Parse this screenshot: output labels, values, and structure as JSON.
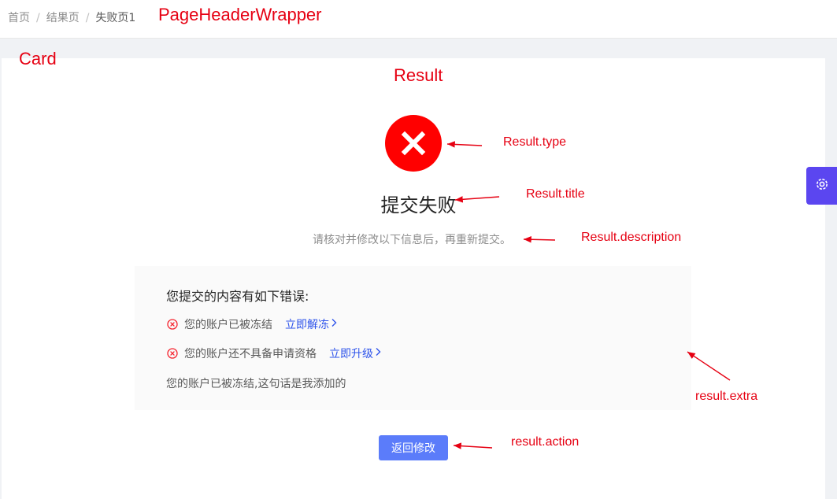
{
  "breadcrumb": {
    "home": "首页",
    "result": "结果页",
    "current": "失败页1",
    "separator": "/"
  },
  "annotations": {
    "page_header": "PageHeaderWrapper",
    "card": "Card",
    "result": "Result",
    "type": "Result.type",
    "title": "Result.title",
    "description": "Result.description",
    "extra": "result.extra",
    "action": "result.action"
  },
  "result": {
    "status": "error",
    "title": "提交失败",
    "description": "请核对并修改以下信息后，再重新提交。"
  },
  "extra": {
    "heading": "您提交的内容有如下错误:",
    "errors": [
      {
        "text": "您的账户已被冻结",
        "link": "立即解冻"
      },
      {
        "text": "您的账户还不具备申请资格",
        "link": "立即升级"
      }
    ],
    "note": "您的账户已被冻结,这句话是我添加的"
  },
  "action": {
    "label": "返回修改"
  },
  "colors": {
    "error": "#ff0000",
    "link": "#2f54eb",
    "primary_button": "#5b7cfa",
    "settings_drawer": "#5b46f0",
    "annotation": "#e60012"
  },
  "icons": {
    "status": "close-circle-filled-icon",
    "error_item": "close-circle-outline-icon",
    "link_arrow": "chevron-right-icon",
    "settings": "gear-icon"
  }
}
